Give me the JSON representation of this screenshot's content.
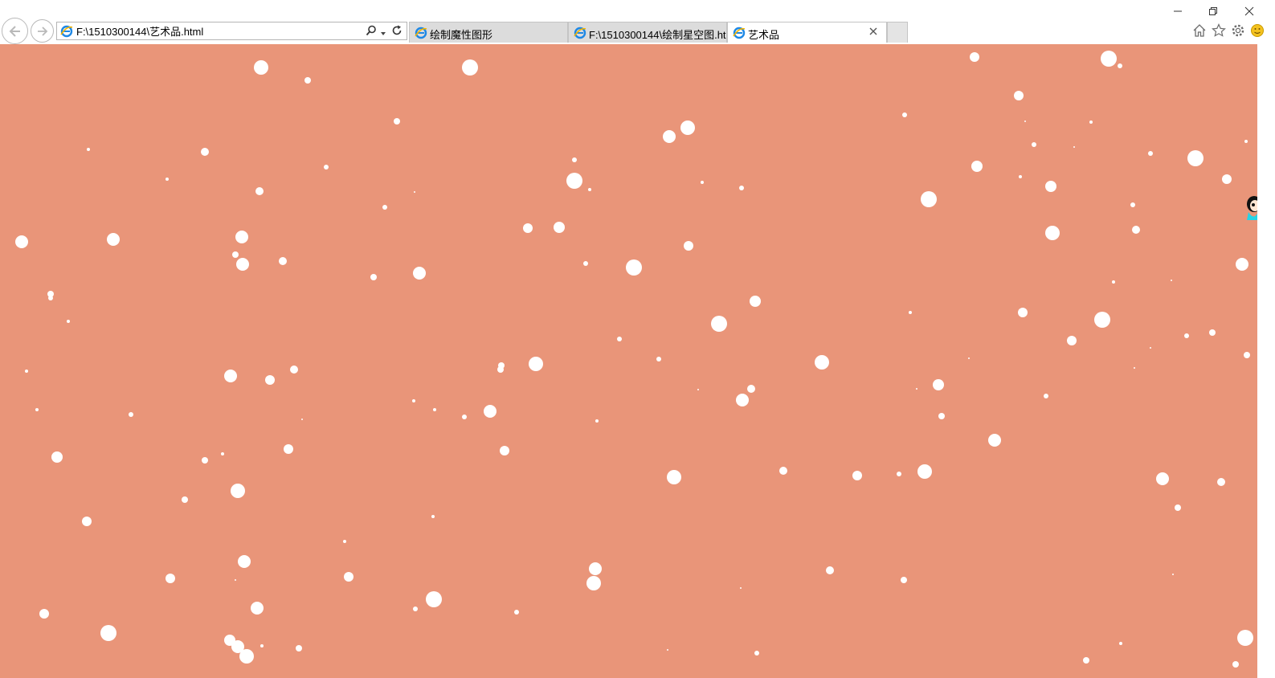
{
  "browser": {
    "address": "F:\\1510300144\\艺术品.html",
    "tabs": [
      {
        "label": "绘制魔性图形",
        "active": false
      },
      {
        "label": "F:\\1510300144\\绘制星空图.ht...",
        "active": false
      },
      {
        "label": "艺术品",
        "active": true
      }
    ],
    "icons": {
      "back": "back-arrow-icon",
      "forward": "forward-arrow-icon",
      "search": "search-icon",
      "dropdown": "chevron-down-icon",
      "refresh": "refresh-icon",
      "close_tab": "close-icon",
      "home": "home-icon",
      "favorites": "star-icon",
      "settings": "gear-icon",
      "feedback": "smiley-icon",
      "minimize": "minimize-icon",
      "restore": "restore-icon",
      "close_window": "close-icon"
    }
  },
  "page": {
    "background_color": "#e99579",
    "snowflake_color": "#ffffff"
  }
}
